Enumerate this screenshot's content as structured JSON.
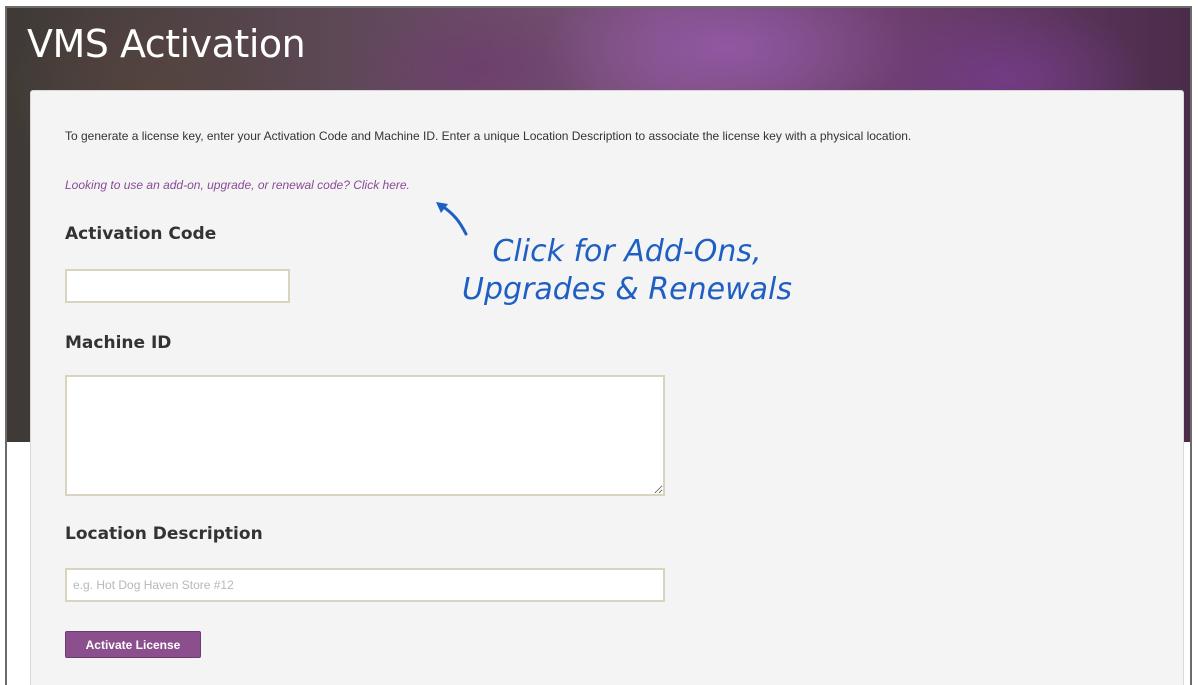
{
  "page": {
    "title": "VMS Activation"
  },
  "form": {
    "intro": "To generate a license key, enter your Activation Code and Machine ID. Enter a unique Location Description to associate the license key with a physical location.",
    "addon_link": "Looking to use an add-on, upgrade, or renewal code? Click here.",
    "activation_code": {
      "label": "Activation Code",
      "value": ""
    },
    "machine_id": {
      "label": "Machine ID",
      "value": ""
    },
    "location_description": {
      "label": "Location Description",
      "value": "",
      "placeholder": "e.g. Hot Dog Haven Store #12"
    },
    "activate_button": "Activate License"
  },
  "annotation": {
    "line1": "Click for Add-Ons,",
    "line2": "Upgrades & Renewals",
    "color": "#1f5fc4"
  },
  "colors": {
    "accent": "#8b4f8d",
    "link": "#8a4a96"
  }
}
